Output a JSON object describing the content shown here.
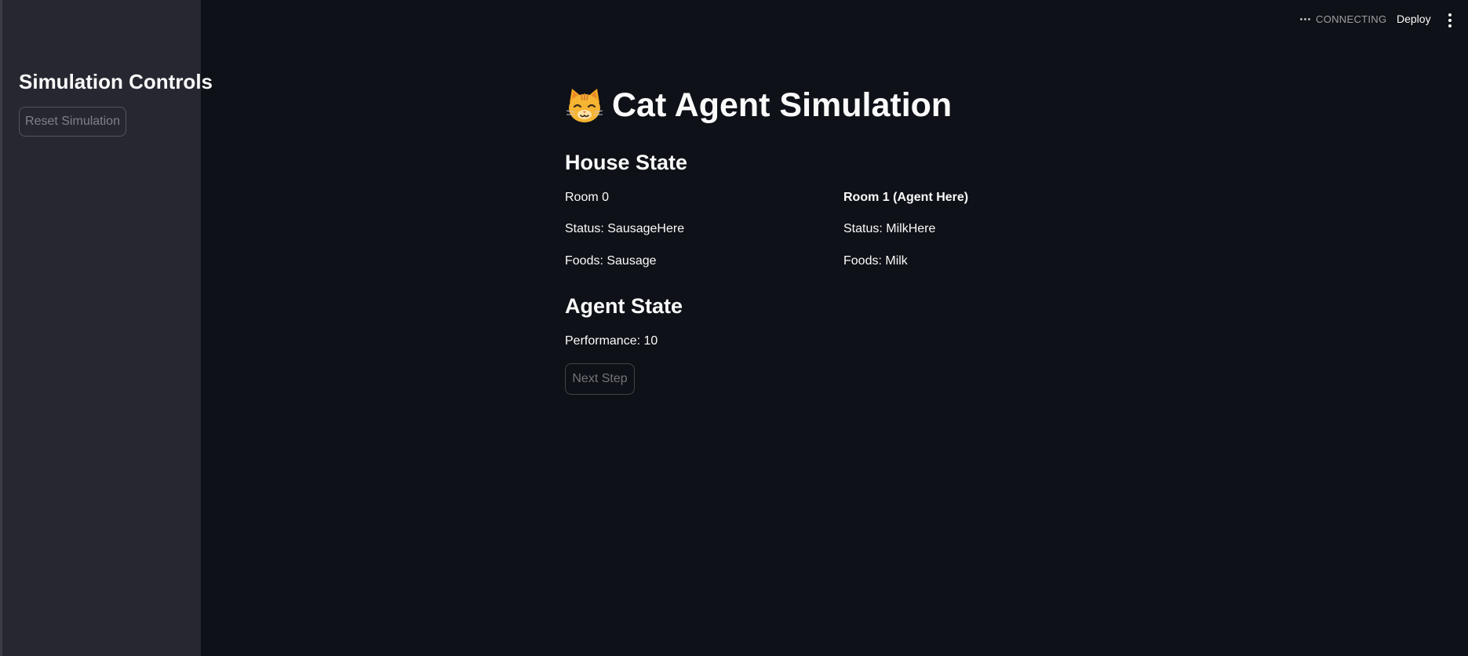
{
  "header": {
    "status_text": "CONNECTING",
    "deploy_label": "Deploy",
    "menu_icon": "vertical-ellipsis-icon"
  },
  "sidebar": {
    "title": "Simulation Controls",
    "reset_button_label": "Reset Simulation"
  },
  "main": {
    "title_icon": "cat-face-icon",
    "title": "Cat Agent Simulation",
    "house_state": {
      "heading": "House State",
      "rooms": [
        {
          "name": "Room 0",
          "status": "Status: SausageHere",
          "foods": "Foods: Sausage"
        },
        {
          "name": "Room 1 (Agent Here)",
          "status": "Status: MilkHere",
          "foods": "Foods: Milk"
        }
      ]
    },
    "agent_state": {
      "heading": "Agent State",
      "performance": "Performance: 10",
      "next_button_label": "Next Step"
    }
  },
  "colors": {
    "background": "#0e1117",
    "sidebar": "#262730",
    "text": "#fafafa"
  }
}
